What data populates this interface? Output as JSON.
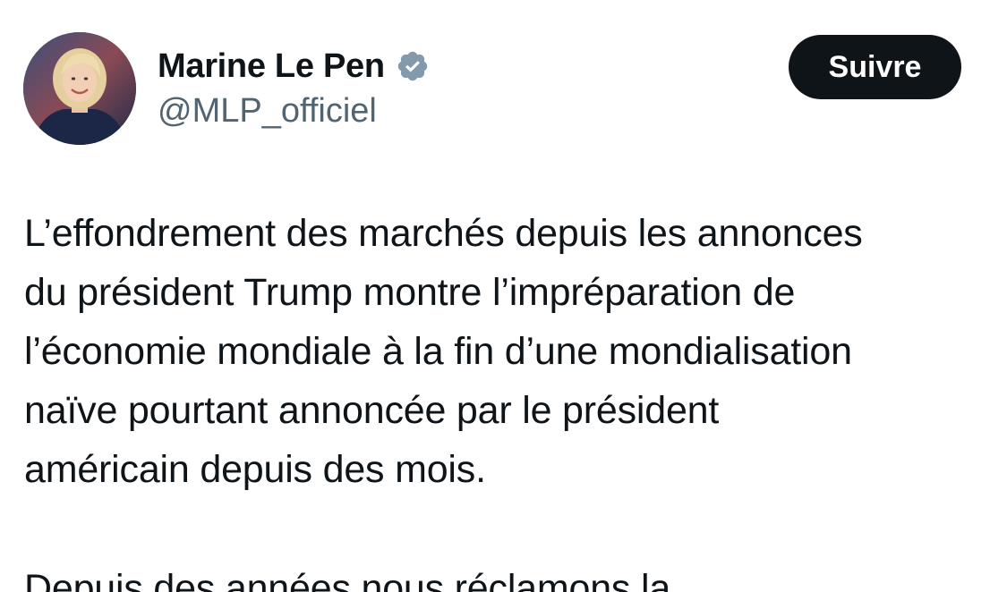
{
  "author": {
    "display_name": "Marine Le Pen",
    "handle": "@MLP_officiel",
    "verified": true,
    "verified_badge_color": "#829aab"
  },
  "actions": {
    "follow_label": "Suivre"
  },
  "tweet": {
    "paragraph_1_lines": [
      "L’effondrement des marchés depuis les annonces",
      "du président Trump montre l’impréparation de",
      "l’économie mondiale à la fin d’une mondialisation",
      "naïve pourtant annoncée par le président",
      "américain depuis des mois."
    ],
    "paragraph_2_first_line": "Depuis des années nous réclamons la"
  },
  "colors": {
    "text": "#0f1419",
    "secondary_text": "#536471",
    "button_bg": "#0f1419",
    "button_text": "#ffffff",
    "background": "#ffffff"
  }
}
